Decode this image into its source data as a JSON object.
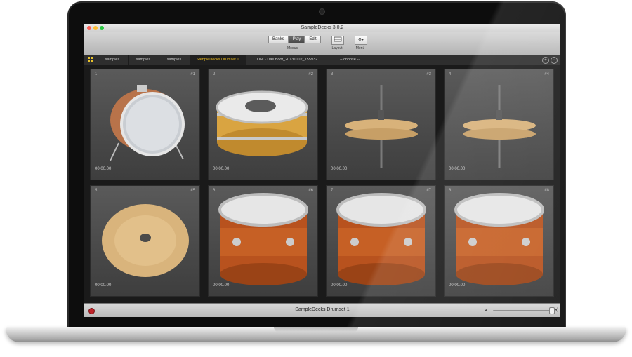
{
  "window": {
    "title": "SampleDecks 3.0.2"
  },
  "toolbar": {
    "modes": [
      {
        "label": "Banks",
        "active": false
      },
      {
        "label": "Play",
        "active": true
      },
      {
        "label": "Edit",
        "active": false
      }
    ],
    "modus_label": "Modus",
    "layout_label": "Layout",
    "menu_label": "Menü",
    "layout_icon": "layout-icon",
    "menu_icon": "gear-icon"
  },
  "tabs": [
    {
      "label": "samples",
      "active": false
    },
    {
      "label": "samples",
      "active": false
    },
    {
      "label": "samples",
      "active": false
    },
    {
      "label": "SampleDecks Drumset 1",
      "active": true
    },
    {
      "label": "UNI - Das Boot_20131002_155932",
      "active": false
    },
    {
      "label": "-- choose --",
      "active": false
    }
  ],
  "tab_controls": {
    "add_icon": "plus-circle-icon",
    "remove_icon": "minus-circle-icon"
  },
  "pads": [
    {
      "number": "1",
      "key": "#1",
      "time": "00:00.00",
      "instrument": "bass-drum"
    },
    {
      "number": "2",
      "key": "#2",
      "time": "00:00.00",
      "instrument": "snare-drum"
    },
    {
      "number": "3",
      "key": "#3",
      "time": "00:00.00",
      "instrument": "hi-hat"
    },
    {
      "number": "4",
      "key": "#4",
      "time": "00:00.00",
      "instrument": "hi-hat"
    },
    {
      "number": "5",
      "key": "#5",
      "time": "00:00.00",
      "instrument": "crash-cymbal"
    },
    {
      "number": "6",
      "key": "#6",
      "time": "00:00.00",
      "instrument": "tom-drum"
    },
    {
      "number": "7",
      "key": "#7",
      "time": "00:00.00",
      "instrument": "tom-drum"
    },
    {
      "number": "8",
      "key": "#8",
      "time": "00:00.00",
      "instrument": "tom-drum"
    }
  ],
  "status": {
    "title": "SampleDecks Drumset 1",
    "volume": 0.98
  },
  "colors": {
    "accent": "#e8b820",
    "record": "#c0242a"
  }
}
